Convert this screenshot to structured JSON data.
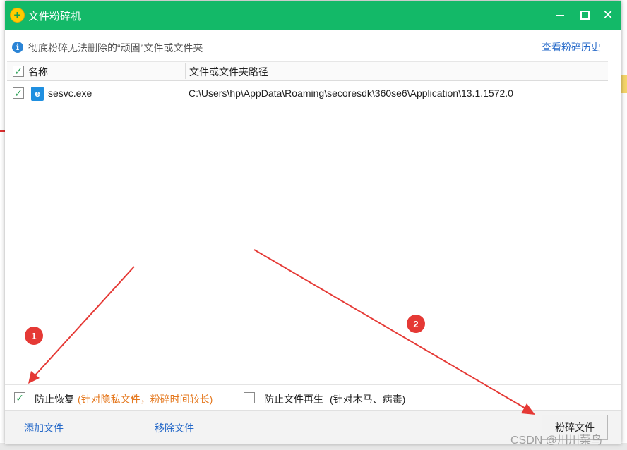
{
  "window": {
    "title": "文件粉碎机",
    "info_text": "彻底粉碎无法删除的“顽固”文件或文件夹",
    "history_link": "查看粉碎历史"
  },
  "table": {
    "headers": [
      "名称",
      "文件或文件夹路径"
    ],
    "rows": [
      {
        "name": "sesvc.exe",
        "path": "C:\\Users\\hp\\AppData\\Roaming\\secoresdk\\360se6\\Application\\13.1.1572.0",
        "checked": true
      }
    ]
  },
  "options": {
    "prevent_recovery_label": "防止恢复",
    "prevent_recovery_note": "(针对隐私文件，粉碎时间较长)",
    "prevent_recovery_checked": true,
    "prevent_regen_label": "防止文件再生",
    "prevent_regen_note": "(针对木马、病毒)",
    "prevent_regen_checked": false
  },
  "footer": {
    "add_file": "添加文件",
    "remove_file": "移除文件",
    "shred_button": "粉碎文件"
  },
  "annotations": [
    "1",
    "2"
  ],
  "watermark": "CSDN @川川菜鸟",
  "colors": {
    "titlebar": "#13b968",
    "link": "#2468c8",
    "orange_note": "#e5781e",
    "annotation_red": "#e53935"
  }
}
